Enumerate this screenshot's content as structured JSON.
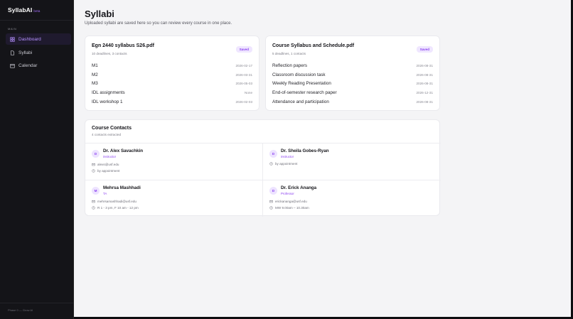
{
  "brand": {
    "name": "SyllabAI",
    "beta": "beta"
  },
  "sidebar": {
    "section_label": "MAIN",
    "items": [
      {
        "label": "Dashboard",
        "icon": "grid-icon",
        "active": true
      },
      {
        "label": "Syllabi",
        "icon": "document-icon",
        "active": false
      },
      {
        "label": "Calendar",
        "icon": "calendar-icon",
        "active": false
      }
    ],
    "footer": "Phase 0 — Grow AI"
  },
  "page": {
    "title": "Syllabi",
    "subtitle": "Uploaded syllabi are saved here so you can review every course in one place."
  },
  "syllabi": [
    {
      "title": "Egn 2440 syllabus S26.pdf",
      "meta": "10 deadlines, 3 contacts",
      "badge": "Saved",
      "deadlines": [
        {
          "name": "M1",
          "date": "2026-02-17"
        },
        {
          "name": "M2",
          "date": "2026-03-31"
        },
        {
          "name": "M3",
          "date": "2026-05-03"
        },
        {
          "name": "IDL assignments",
          "date": "None"
        },
        {
          "name": "IDL workshop 1",
          "date": "2026-02-03"
        }
      ]
    },
    {
      "title": "Course Syllabus and Schedule.pdf",
      "meta": "5 deadlines, 1 contacts",
      "badge": "Saved",
      "deadlines": [
        {
          "name": "Reflection papers",
          "date": "2026-08-31"
        },
        {
          "name": "Classroom discussion task",
          "date": "2026-08-31"
        },
        {
          "name": "Weekly Reading Presentation",
          "date": "2026-08-31"
        },
        {
          "name": "End-of-semester research paper",
          "date": "2026-12-31"
        },
        {
          "name": "Attendance and participation",
          "date": "2026-08-31"
        }
      ]
    }
  ],
  "contacts": {
    "title": "Course Contacts",
    "meta": "4 contacts extracted",
    "items": [
      {
        "initial": "D",
        "name": "Dr. Alex Savachkin",
        "role": "instructor",
        "email": "alexs@usf.edu",
        "hours": "by appointment"
      },
      {
        "initial": "D",
        "name": "Dr. Sheila Gobes-Ryan",
        "role": "instructor",
        "email": "",
        "hours": "by appointment"
      },
      {
        "initial": "M",
        "name": "Mehrsa Mashhadi",
        "role": "TA",
        "email": "mehrsamashhadi@usf.edu",
        "hours": "R 1 - 3 pm, F 10 am - 12 pm"
      },
      {
        "initial": "D",
        "name": "Dr. Erick Ananga",
        "role": "Professor",
        "email": "erickananga@usf.edu",
        "hours": "MW 9.00am – 10.30am"
      }
    ]
  },
  "colors": {
    "accent": "#8a3ff0",
    "badge_bg": "#efe6ff",
    "sidebar_bg": "#141418",
    "main_bg": "#f4f4f6"
  }
}
